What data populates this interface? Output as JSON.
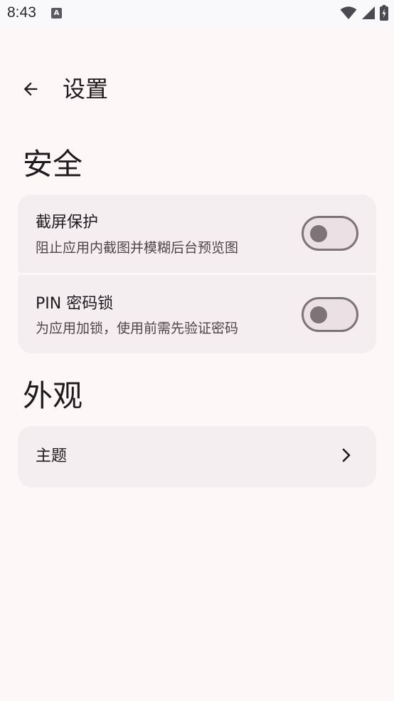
{
  "status_bar": {
    "time": "8:43",
    "notification_glyph": "A",
    "icons": [
      "wifi-icon",
      "signal-icon",
      "battery-charging-icon"
    ]
  },
  "header": {
    "title": "设置",
    "back_icon": "arrow-back-icon"
  },
  "sections": [
    {
      "heading": "安全",
      "items": [
        {
          "title": "截屏保护",
          "subtitle": "阻止应用内截图并模糊后台预览图",
          "control": "switch",
          "checked": false
        },
        {
          "title": "PIN 密码锁",
          "subtitle": "为应用加锁，使用前需先验证密码",
          "control": "switch",
          "checked": false
        }
      ]
    },
    {
      "heading": "外观",
      "items": [
        {
          "title": "主题",
          "control": "chevron-right-icon"
        }
      ]
    }
  ],
  "colors": {
    "background": "#fef7f8",
    "card": "#f5eef1",
    "switch_outline": "#7e7478",
    "switch_track": "#ebe1e5",
    "text_primary": "#1d1b1e",
    "text_secondary": "#4d4548"
  }
}
